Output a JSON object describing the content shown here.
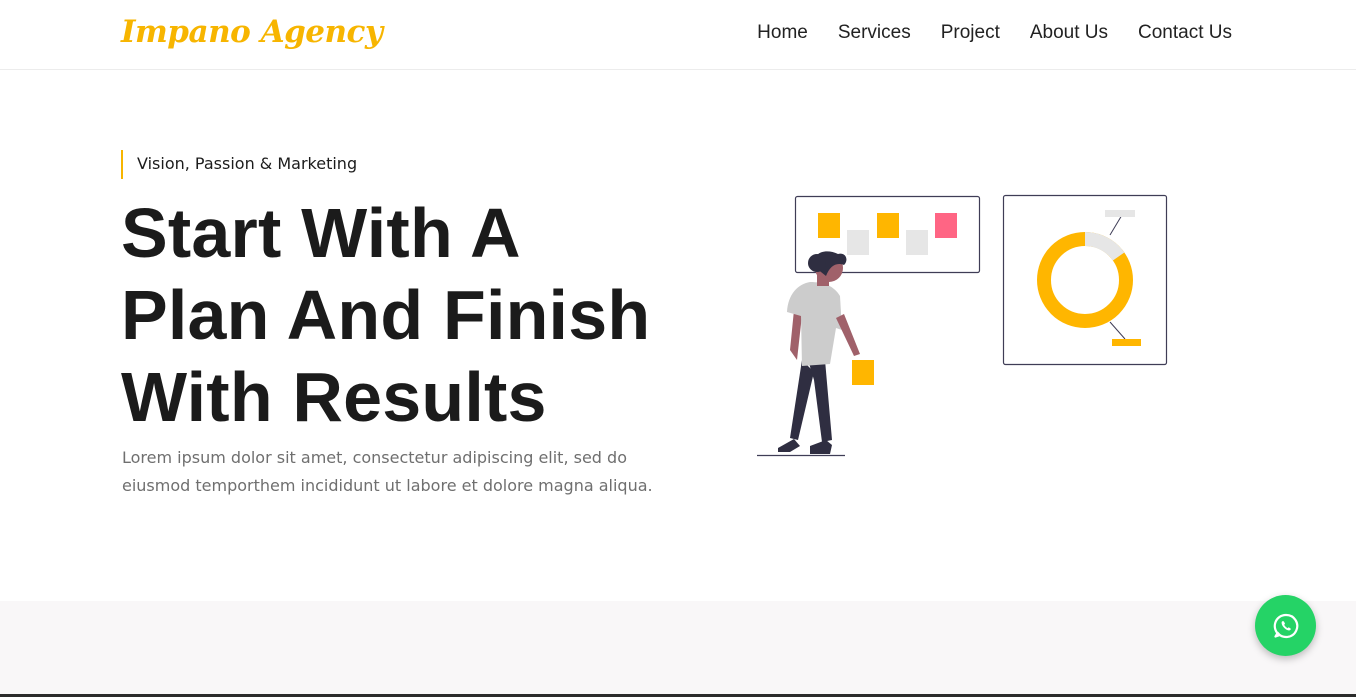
{
  "header": {
    "logo_text": "Impano Agency",
    "nav": [
      "Home",
      "Services",
      "Project",
      "About Us",
      "Contact Us"
    ]
  },
  "hero": {
    "tagline": "Vision, Passion & Marketing",
    "headline_lines": [
      "Start With A",
      "Plan And Finish",
      "With Results"
    ],
    "lead": "Lorem ipsum dolor sit amet, consectetur adipiscing elit, sed do eiusmod temporthem incididunt ut labore et dolore magna aliqua."
  },
  "floating": {
    "whatsapp_icon": "whatsapp-icon"
  },
  "colors": {
    "accent": "#f7b500",
    "heading": "#1b1b1b",
    "body_text": "#6f6f6f",
    "whatsapp": "#25d366",
    "sticky_pink": "#ff6584",
    "band": "#f9f7f8"
  }
}
